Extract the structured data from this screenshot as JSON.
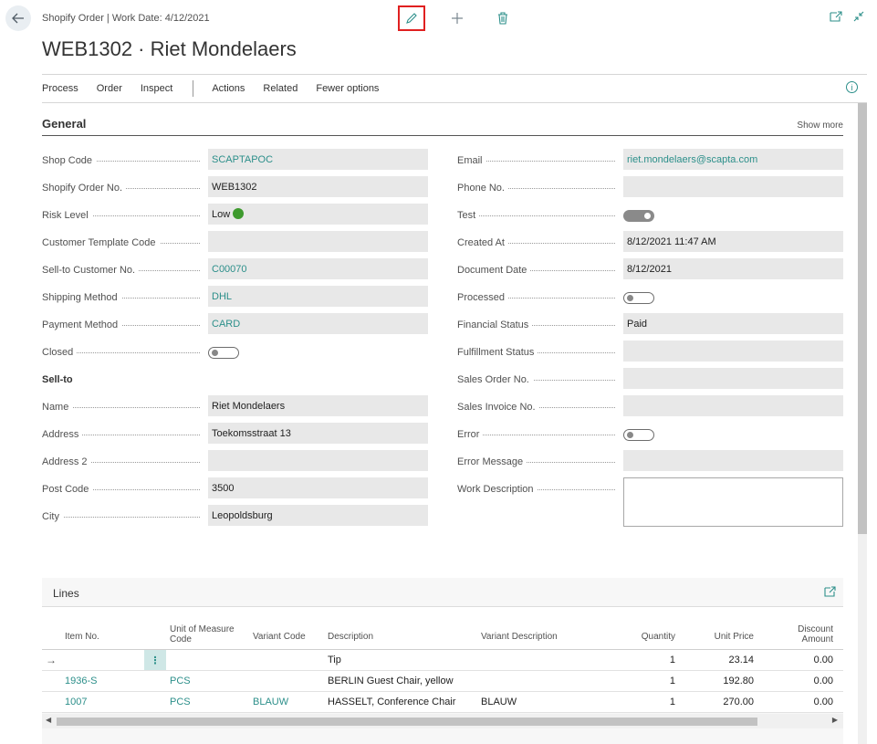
{
  "header": {
    "breadcrumb": "Shopify Order | Work Date: 4/12/2021",
    "title": "WEB1302 · Riet Mondelaers"
  },
  "actions": [
    "Process",
    "Order",
    "Inspect",
    "Actions",
    "Related",
    "Fewer options"
  ],
  "general": {
    "title": "General",
    "show_more": "Show more",
    "left": {
      "shop_code": {
        "label": "Shop Code",
        "value": "SCAPTAPOC"
      },
      "order_no": {
        "label": "Shopify Order No.",
        "value": "WEB1302"
      },
      "risk_level": {
        "label": "Risk Level",
        "value": "Low"
      },
      "customer_template": {
        "label": "Customer Template Code",
        "value": ""
      },
      "sell_to_customer": {
        "label": "Sell-to Customer No.",
        "value": "C00070"
      },
      "shipping_method": {
        "label": "Shipping Method",
        "value": "DHL"
      },
      "payment_method": {
        "label": "Payment Method",
        "value": "CARD"
      },
      "closed": {
        "label": "Closed",
        "value": false
      },
      "sell_to_heading": "Sell-to",
      "name": {
        "label": "Name",
        "value": "Riet Mondelaers"
      },
      "address": {
        "label": "Address",
        "value": "Toekomsstraat 13"
      },
      "address2": {
        "label": "Address 2",
        "value": ""
      },
      "post_code": {
        "label": "Post Code",
        "value": "3500"
      },
      "city": {
        "label": "City",
        "value": "Leopoldsburg"
      }
    },
    "right": {
      "email": {
        "label": "Email",
        "value": "riet.mondelaers@scapta.com"
      },
      "phone": {
        "label": "Phone No.",
        "value": ""
      },
      "test": {
        "label": "Test",
        "value": true
      },
      "created_at": {
        "label": "Created At",
        "value": "8/12/2021 11:47 AM"
      },
      "document_date": {
        "label": "Document Date",
        "value": "8/12/2021"
      },
      "processed": {
        "label": "Processed",
        "value": false
      },
      "financial_status": {
        "label": "Financial Status",
        "value": "Paid"
      },
      "fulfillment_status": {
        "label": "Fulfillment Status",
        "value": ""
      },
      "sales_order_no": {
        "label": "Sales Order No.",
        "value": ""
      },
      "sales_invoice_no": {
        "label": "Sales Invoice No.",
        "value": ""
      },
      "error": {
        "label": "Error",
        "value": false
      },
      "error_message": {
        "label": "Error Message",
        "value": ""
      },
      "work_description": {
        "label": "Work Description",
        "value": ""
      }
    }
  },
  "lines": {
    "title": "Lines",
    "columns": {
      "item_no": "Item No.",
      "uom_line1": "Unit of Measure",
      "uom_line2": "Code",
      "variant_code": "Variant Code",
      "description": "Description",
      "variant_description": "Variant Description",
      "quantity": "Quantity",
      "unit_price": "Unit Price",
      "discount_line1": "Discount",
      "discount_line2": "Amount"
    },
    "rows": [
      {
        "item_no": "",
        "uom": "",
        "variant_code": "",
        "description": "Tip",
        "variant_description": "",
        "quantity": "1",
        "unit_price": "23.14",
        "discount": "0.00"
      },
      {
        "item_no": "1936-S",
        "uom": "PCS",
        "variant_code": "",
        "description": "BERLIN Guest Chair, yellow",
        "variant_description": "",
        "quantity": "1",
        "unit_price": "192.80",
        "discount": "0.00"
      },
      {
        "item_no": "1007",
        "uom": "PCS",
        "variant_code": "BLAUW",
        "description": "HASSELT, Conference Chair",
        "variant_description": "BLAUW",
        "quantity": "1",
        "unit_price": "270.00",
        "discount": "0.00"
      }
    ]
  }
}
